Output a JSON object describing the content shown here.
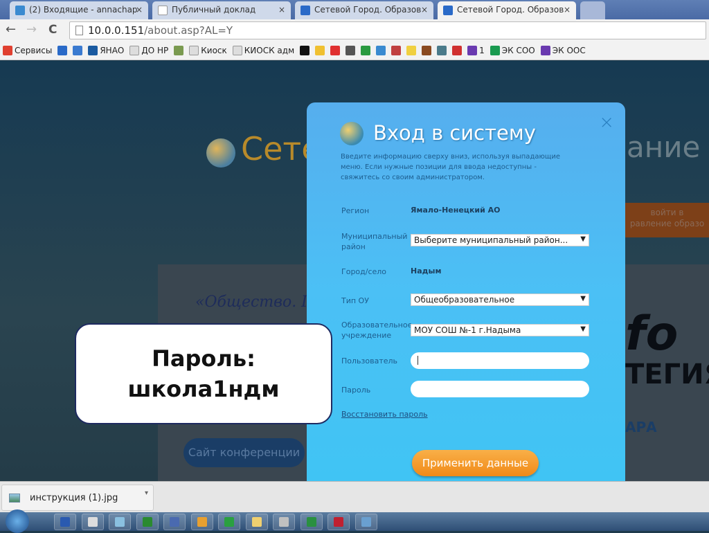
{
  "browser": {
    "tabs": [
      {
        "title": "(2) Входящие - annachap",
        "active": false,
        "color": "#3a8ad0"
      },
      {
        "title": "Публичный доклад",
        "active": false,
        "color": "#ffffff"
      },
      {
        "title": "Сетевой Город. Образов",
        "active": false,
        "color": "#2a6ac8"
      },
      {
        "title": "Сетевой Город. Образов",
        "active": true,
        "color": "#2a6ac8"
      }
    ],
    "close_glyph": "×",
    "url_host": "10.0.0.151",
    "url_path": "/about.asp?AL=Y",
    "nav": {
      "back": "←",
      "forward": "→",
      "reload": "C"
    },
    "bookmarks": [
      {
        "label": "Сервисы",
        "color": "#e04030"
      },
      {
        "label": "",
        "color": "#2a6ac8"
      },
      {
        "label": "",
        "color": "#3a7ad0"
      },
      {
        "label": "ЯНАО",
        "color": "#1a5aa0"
      },
      {
        "label": "ДО НР",
        "color": "#dddddd"
      },
      {
        "label": "",
        "color": "#7a9a50"
      },
      {
        "label": "Киоск",
        "color": "#dddddd"
      },
      {
        "label": "КИОСК адм",
        "color": "#dddddd"
      },
      {
        "label": "",
        "color": "#111111"
      },
      {
        "label": "",
        "color": "#f0c030"
      },
      {
        "label": "",
        "color": "#e03030"
      },
      {
        "label": "",
        "color": "#555555"
      },
      {
        "label": "",
        "color": "#2a9a40"
      },
      {
        "label": "",
        "color": "#3a8ad0"
      },
      {
        "label": "",
        "color": "#c04040"
      },
      {
        "label": "",
        "color": "#f0d040"
      },
      {
        "label": "",
        "color": "#8a4a20"
      },
      {
        "label": "",
        "color": "#4a7a8a"
      },
      {
        "label": "",
        "color": "#d03030"
      },
      {
        "label": "1",
        "color": "#6a3ab0"
      },
      {
        "label": "ЭК СОО",
        "color": "#1a9a50"
      },
      {
        "label": "ЭК ООС",
        "color": "#6a3ab0"
      }
    ]
  },
  "site": {
    "logo_left": "Сете",
    "logo_right": "ание",
    "quote": "«Общество. Гос",
    "login_button": "войти в\nравление образо",
    "conference_button": "Сайт конференции",
    "banner_fo": "fo",
    "banner_tegia": "ТЕГИЯ",
    "banner_ara": "АРА"
  },
  "login": {
    "title": "Вход в систему",
    "close": "×",
    "description": "Введите информацию сверху вниз, используя выпадающие меню. Если нужные позиции для ввода недоступны - свяжитесь со своим администратором.",
    "region_label": "Регион",
    "region_value": "Ямало-Ненецкий АО",
    "district_label": "Муниципальный район",
    "district_value": "Выберите муниципальный район...",
    "city_label": "Город/село",
    "city_value": "Надым",
    "type_label": "Тип ОУ",
    "type_value": "Общеобразовательное",
    "school_label": "Образовательное учреждение",
    "school_value": "МОУ СОШ №-1 г.Надыма",
    "user_label": "Пользователь",
    "user_value": "",
    "password_label": "Пароль",
    "password_value": "",
    "restore_link": "Восстановить пароль",
    "submit": "Применить данные",
    "dropdown_arrow": "▼"
  },
  "callout": {
    "line1": "Пароль:",
    "line2": "школа1ндм"
  },
  "downloads": {
    "file": "инструкция (1).jpg",
    "menu": "▾"
  },
  "taskbar": {
    "apps": [
      "word",
      "solitaire",
      "notepad",
      "sim",
      "paint",
      "chrome",
      "mail-agent",
      "explorer",
      "clock",
      "excel",
      "access",
      "image-viewer"
    ]
  }
}
